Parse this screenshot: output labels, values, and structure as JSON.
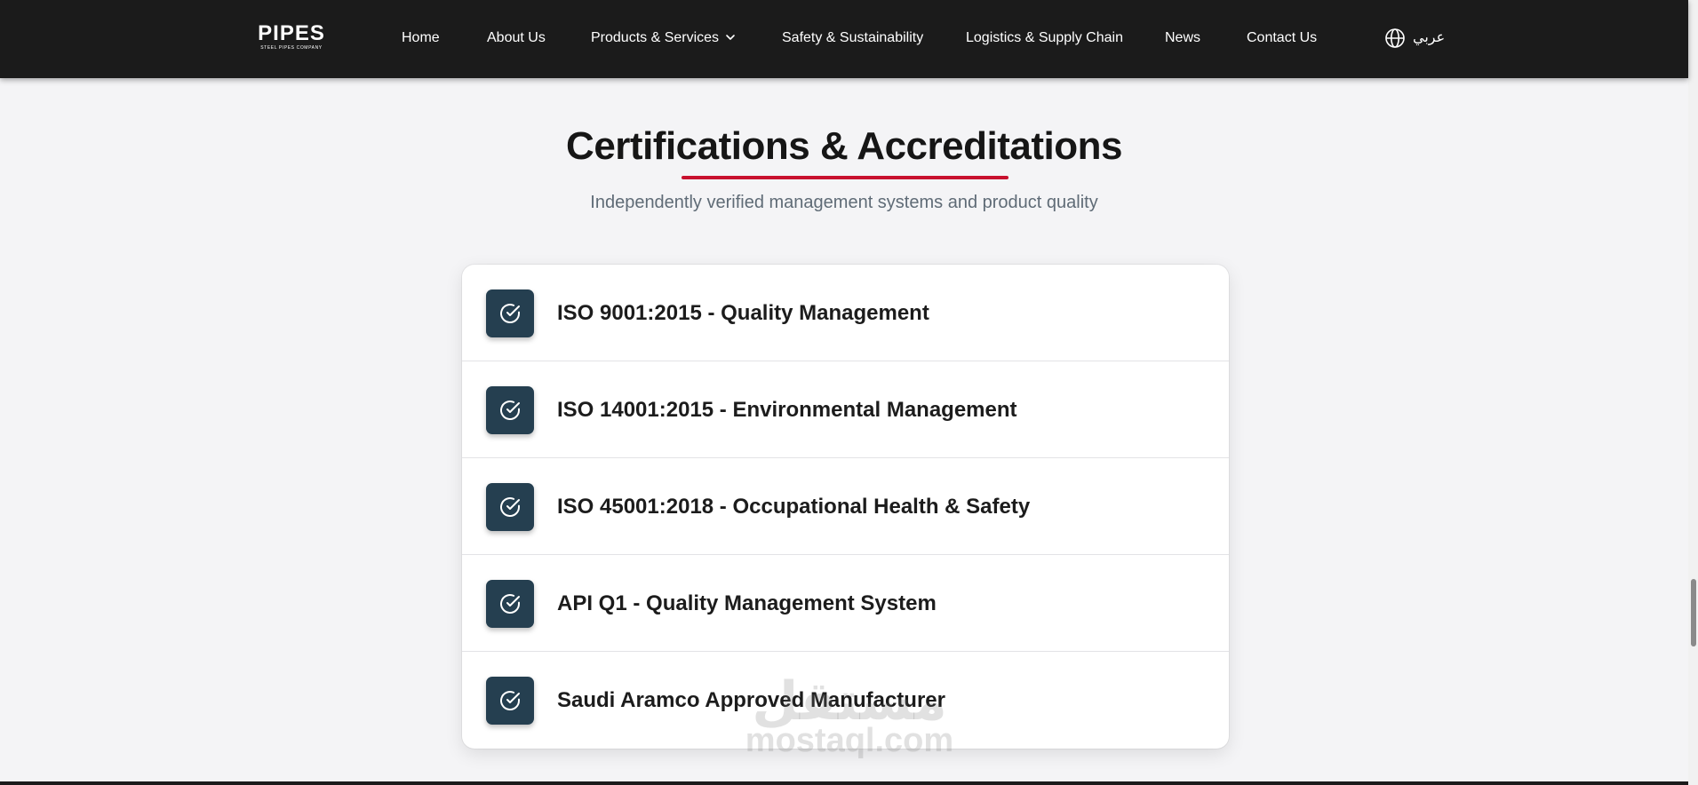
{
  "header": {
    "logo_text": "PIPES",
    "logo_tagline": "STEEL PIPES COMPANY",
    "nav": [
      {
        "label": "Home"
      },
      {
        "label": "About Us"
      },
      {
        "label": "Products & Services",
        "has_dropdown": true
      },
      {
        "label": "Safety & Sustainability"
      },
      {
        "label": "Logistics & Supply Chain"
      },
      {
        "label": "News"
      },
      {
        "label": "Contact Us"
      }
    ],
    "language_label": "عربي",
    "language_icon": "globe-icon"
  },
  "section": {
    "title": "Certifications & Accreditations",
    "subtitle": "Independently verified management systems and product quality",
    "accent_color": "#c8102e"
  },
  "certifications": [
    {
      "label": "ISO 9001:2015 - Quality Management",
      "icon": "check-circle-icon"
    },
    {
      "label": "ISO 14001:2015 - Environmental Management",
      "icon": "check-circle-icon"
    },
    {
      "label": "ISO 45001:2018 - Occupational Health & Safety",
      "icon": "check-circle-icon"
    },
    {
      "label": "API Q1 - Quality Management System",
      "icon": "check-circle-icon"
    },
    {
      "label": "Saudi Aramco Approved Manufacturer",
      "icon": "check-circle-icon"
    }
  ],
  "watermark": {
    "arabic": "مستقل",
    "latin": "mostaql.com"
  },
  "colors": {
    "header_bg": "#1b1b1b",
    "badge_bg": "#253f50",
    "page_bg": "#f4f4f6"
  }
}
